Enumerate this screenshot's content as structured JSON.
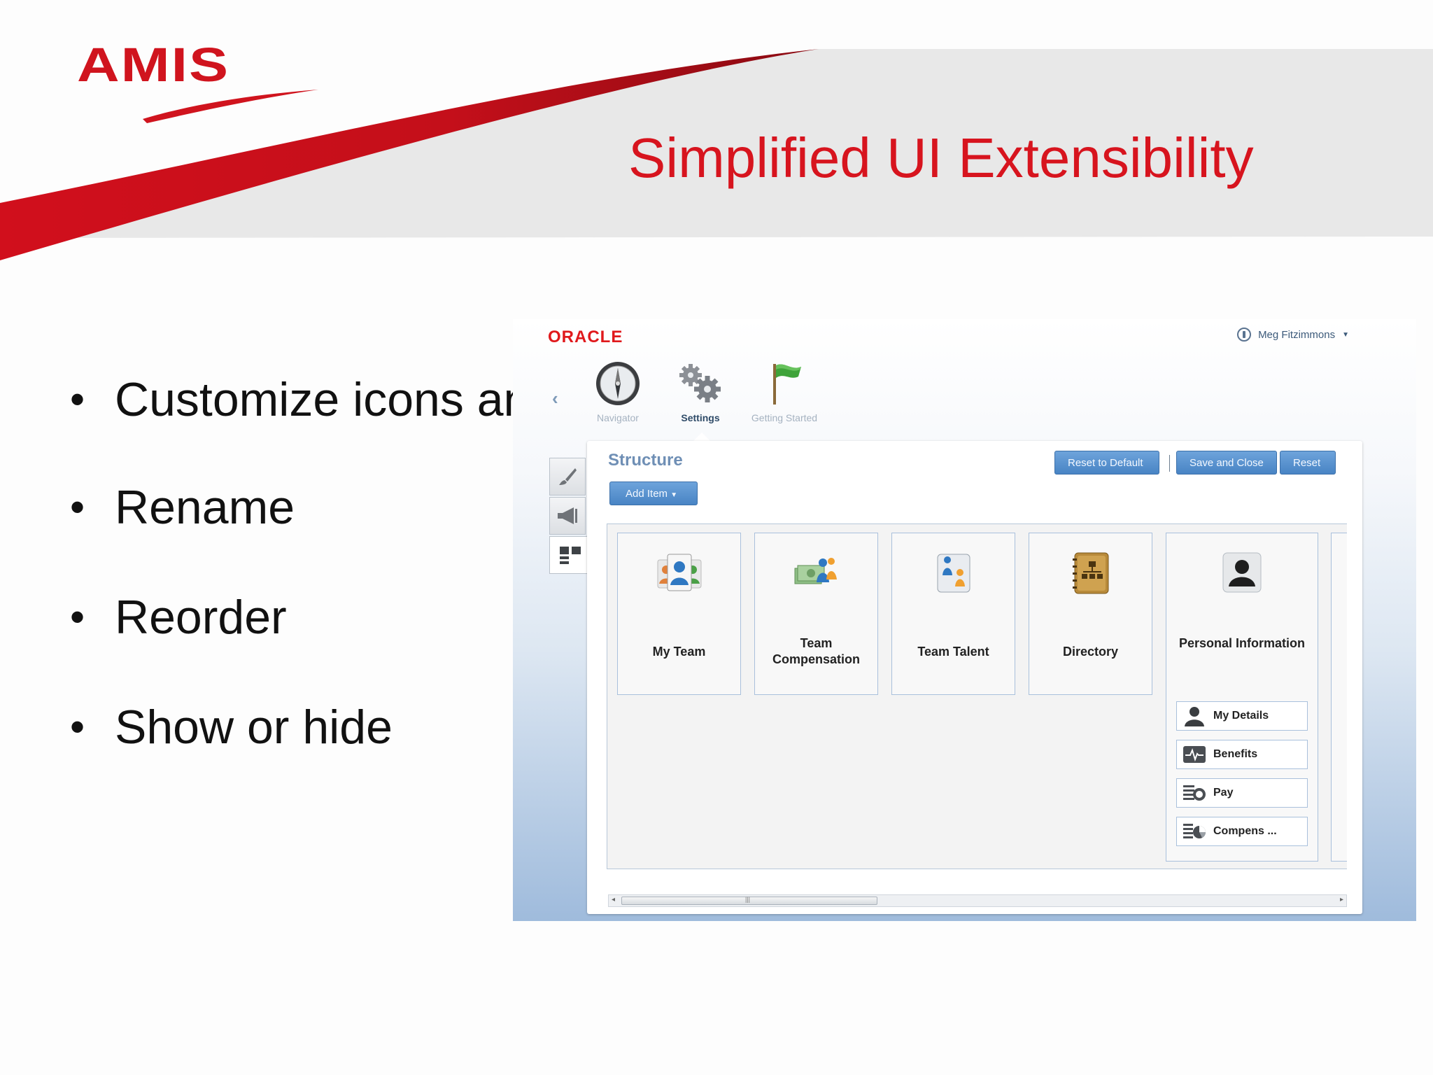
{
  "slide": {
    "logo": "AMIS",
    "title": "Simplified UI Extensibility",
    "bullets": [
      "Customize icons and tabs",
      "Rename",
      "Reorder",
      "Show or hide"
    ]
  },
  "app": {
    "brand": "ORACLE",
    "user_name": "Meg Fitzimmons",
    "nav": [
      {
        "label": "Navigator",
        "icon": "compass-icon"
      },
      {
        "label": "Settings",
        "icon": "gears-icon",
        "selected": true
      },
      {
        "label": "Getting Started",
        "icon": "flag-icon"
      }
    ],
    "side_tools": [
      "brush-icon",
      "megaphone-icon",
      "structure-icon"
    ],
    "panel": {
      "title": "Structure",
      "buttons": {
        "reset_default": "Reset to Default",
        "save_close": "Save and Close",
        "reset": "Reset",
        "add_item": "Add Item"
      },
      "cards": [
        {
          "label": "My Team",
          "icon": "team-icon"
        },
        {
          "label": "Team Compensation",
          "icon": "money-people-icon"
        },
        {
          "label": "Team Talent",
          "icon": "talent-icon"
        },
        {
          "label": "Directory",
          "icon": "org-chart-book-icon"
        },
        {
          "label": "Personal Information",
          "icon": "person-silhouette-icon"
        }
      ],
      "sub_items": [
        {
          "label": "My Details",
          "icon": "person-icon"
        },
        {
          "label": "Benefits",
          "icon": "heartbeat-icon"
        },
        {
          "label": "Pay",
          "icon": "pay-icon"
        },
        {
          "label": "Compens ...",
          "icon": "pie-chart-icon"
        }
      ]
    },
    "colors": {
      "oracle_red": "#e0191c",
      "title_red": "#d7141e",
      "button_blue": "#4884c4"
    }
  }
}
